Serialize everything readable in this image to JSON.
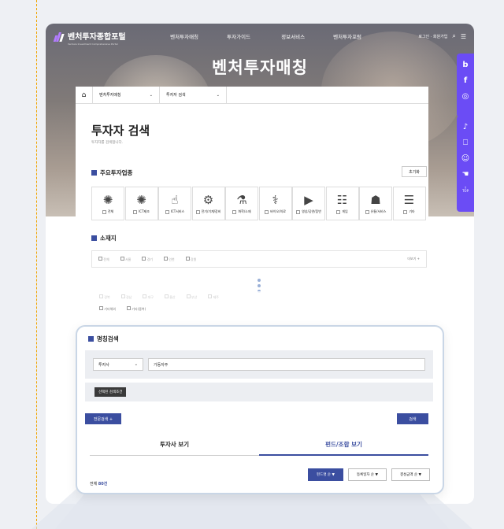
{
  "nav": {
    "logo": "벤처투자종합포털",
    "logo_sub": "Venture Investment Comprehensive Portal",
    "menu": [
      "벤처투자매칭",
      "투자가이드",
      "정보서비스",
      "벤처투자포럼"
    ],
    "util": "로그인 · 회원가입"
  },
  "hero_title": "벤처투자매칭",
  "sidebar": {
    "items_top": [
      "b",
      "f",
      "instagram"
    ],
    "items_bottom": [
      "bell",
      "bookmark",
      "chatbot",
      "touch",
      "top"
    ],
    "top_label": "TOP"
  },
  "breadcrumb": {
    "level1": "벤처투자매칭",
    "level2": "투자자 검색"
  },
  "page": {
    "title": "투자자 검색",
    "subtitle": "투자자를 검색합니다."
  },
  "industry": {
    "heading": "주요투자업종",
    "reset_label": "초기화",
    "items": [
      {
        "icon": "sun-icon",
        "glyph": "✺",
        "label": "전체"
      },
      {
        "icon": "sun-icon",
        "glyph": "✺",
        "label": "ICT제조"
      },
      {
        "icon": "thumb-icon",
        "glyph": "☝",
        "label": "ICT서비스"
      },
      {
        "icon": "gear-icon",
        "glyph": "⚙",
        "label": "전기/기계/장비"
      },
      {
        "icon": "flask-icon",
        "glyph": "⚗",
        "label": "화학/소재"
      },
      {
        "icon": "microscope-icon",
        "glyph": "⚕",
        "label": "바이오/의료"
      },
      {
        "icon": "video-icon",
        "glyph": "▶",
        "label": "영상/공연/음반"
      },
      {
        "icon": "game-icon",
        "glyph": "☷",
        "label": "게임"
      },
      {
        "icon": "basket-icon",
        "glyph": "☗",
        "label": "유통/서비스"
      },
      {
        "icon": "list-icon",
        "glyph": "☰",
        "label": "기타"
      }
    ]
  },
  "region": {
    "heading": "소재지",
    "options": [
      "전체",
      "서울",
      "경기",
      "인천",
      "강원"
    ],
    "more_label": "더보기 +",
    "options_faint": [
      "경북",
      "경남",
      "대구",
      "울산",
      "부산",
      "제주"
    ],
    "options_last": [
      "기타해외",
      "기타(중복)"
    ]
  },
  "name_search": {
    "heading": "명칭검색",
    "select_value": "투자사",
    "keyword_value": "가동자주",
    "condition_tag": "선택된 검색조건",
    "advanced_label": "전문검색 +",
    "search_label": "검색"
  },
  "tabs": [
    "투자사 보기",
    "펀드/조합 보기"
  ],
  "results": {
    "total_prefix": "전체",
    "total_count": "80건",
    "sorts": [
      "펀드명 순 ▼",
      "등록일자 순 ▼",
      "결성금액 순 ▼"
    ]
  }
}
